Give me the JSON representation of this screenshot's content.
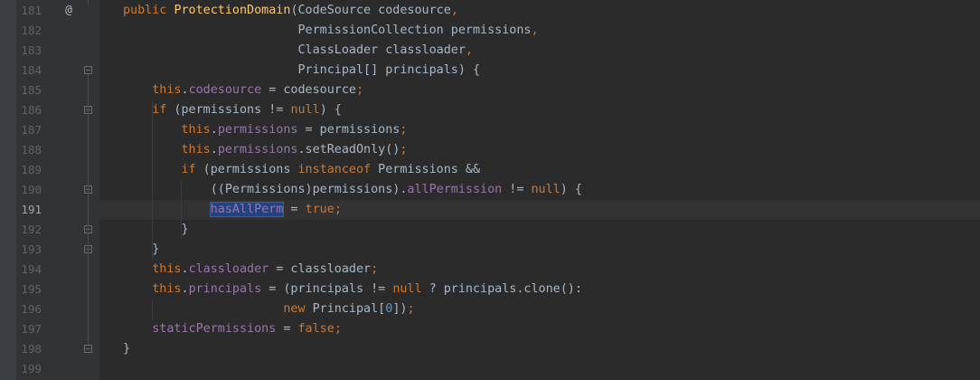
{
  "editor": {
    "lines": [
      {
        "num": "181",
        "segments": [
          {
            "t": "public ",
            "c": "kw"
          },
          {
            "t": "ProtectionDomain",
            "c": "fn"
          },
          {
            "t": "(CodeSource codesource",
            "c": ""
          },
          {
            "t": ",",
            "c": "kw"
          }
        ]
      },
      {
        "num": "182",
        "segments": [
          {
            "t": "                        PermissionCollection permissions",
            "c": ""
          },
          {
            "t": ",",
            "c": "kw"
          }
        ]
      },
      {
        "num": "183",
        "segments": [
          {
            "t": "                        ClassLoader classloader",
            "c": ""
          },
          {
            "t": ",",
            "c": "kw"
          }
        ]
      },
      {
        "num": "184",
        "segments": [
          {
            "t": "                        Principal[] principals) {",
            "c": ""
          }
        ]
      },
      {
        "num": "185",
        "segments": [
          {
            "t": "    ",
            "c": ""
          },
          {
            "t": "this",
            "c": "kw"
          },
          {
            "t": ".",
            "c": ""
          },
          {
            "t": "codesource",
            "c": "fld"
          },
          {
            "t": " = codesource",
            "c": ""
          },
          {
            "t": ";",
            "c": "kw"
          }
        ]
      },
      {
        "num": "186",
        "segments": [
          {
            "t": "    ",
            "c": ""
          },
          {
            "t": "if",
            "c": "kw"
          },
          {
            "t": " (permissions != ",
            "c": ""
          },
          {
            "t": "null",
            "c": "kw"
          },
          {
            "t": ") {",
            "c": ""
          }
        ]
      },
      {
        "num": "187",
        "segments": [
          {
            "t": "        ",
            "c": ""
          },
          {
            "t": "this",
            "c": "kw"
          },
          {
            "t": ".",
            "c": ""
          },
          {
            "t": "permissions",
            "c": "fld"
          },
          {
            "t": " = permissions",
            "c": ""
          },
          {
            "t": ";",
            "c": "kw"
          }
        ]
      },
      {
        "num": "188",
        "segments": [
          {
            "t": "        ",
            "c": ""
          },
          {
            "t": "this",
            "c": "kw"
          },
          {
            "t": ".",
            "c": ""
          },
          {
            "t": "permissions",
            "c": "fld"
          },
          {
            "t": ".setReadOnly()",
            "c": ""
          },
          {
            "t": ";",
            "c": "kw"
          }
        ]
      },
      {
        "num": "189",
        "segments": [
          {
            "t": "        ",
            "c": ""
          },
          {
            "t": "if",
            "c": "kw"
          },
          {
            "t": " (permissions ",
            "c": ""
          },
          {
            "t": "instanceof",
            "c": "kw"
          },
          {
            "t": " Permissions &&",
            "c": ""
          }
        ]
      },
      {
        "num": "190",
        "segments": [
          {
            "t": "            ((Permissions)permissions).",
            "c": ""
          },
          {
            "t": "allPermission",
            "c": "fld"
          },
          {
            "t": " != ",
            "c": ""
          },
          {
            "t": "null",
            "c": "kw"
          },
          {
            "t": ") {",
            "c": ""
          }
        ]
      },
      {
        "num": "191",
        "segments": [
          {
            "t": "            ",
            "c": ""
          },
          {
            "t": "hasAllPerm",
            "c": "sel"
          },
          {
            "t": " = ",
            "c": ""
          },
          {
            "t": "true",
            "c": "kw"
          },
          {
            "t": ";",
            "c": "kw"
          }
        ]
      },
      {
        "num": "192",
        "segments": [
          {
            "t": "        }",
            "c": ""
          }
        ]
      },
      {
        "num": "193",
        "segments": [
          {
            "t": "    }",
            "c": ""
          }
        ]
      },
      {
        "num": "194",
        "segments": [
          {
            "t": "    ",
            "c": ""
          },
          {
            "t": "this",
            "c": "kw"
          },
          {
            "t": ".",
            "c": ""
          },
          {
            "t": "classloader",
            "c": "fld"
          },
          {
            "t": " = classloader",
            "c": ""
          },
          {
            "t": ";",
            "c": "kw"
          }
        ]
      },
      {
        "num": "195",
        "segments": [
          {
            "t": "    ",
            "c": ""
          },
          {
            "t": "this",
            "c": "kw"
          },
          {
            "t": ".",
            "c": ""
          },
          {
            "t": "principals",
            "c": "fld"
          },
          {
            "t": " = (principals != ",
            "c": ""
          },
          {
            "t": "null",
            "c": "kw"
          },
          {
            "t": " ? principals.clone():",
            "c": ""
          }
        ]
      },
      {
        "num": "196",
        "segments": [
          {
            "t": "                      ",
            "c": ""
          },
          {
            "t": "new",
            "c": "kw"
          },
          {
            "t": " Principal[",
            "c": ""
          },
          {
            "t": "0",
            "c": "num"
          },
          {
            "t": "])",
            "c": ""
          },
          {
            "t": ";",
            "c": "kw"
          }
        ]
      },
      {
        "num": "197",
        "segments": [
          {
            "t": "    ",
            "c": ""
          },
          {
            "t": "staticPermissions",
            "c": "fld"
          },
          {
            "t": " = ",
            "c": ""
          },
          {
            "t": "false",
            "c": "kw"
          },
          {
            "t": ";",
            "c": "kw"
          }
        ]
      },
      {
        "num": "198",
        "segments": [
          {
            "t": "}",
            "c": ""
          }
        ]
      },
      {
        "num": "199",
        "segments": []
      }
    ],
    "current_line": "191",
    "at_icon": "@",
    "colors": {
      "background": "#2b2b2b",
      "keyword": "#cc7832",
      "field": "#9876aa",
      "method": "#ffc66d",
      "number": "#6897bb",
      "text": "#a9b7c6"
    }
  }
}
